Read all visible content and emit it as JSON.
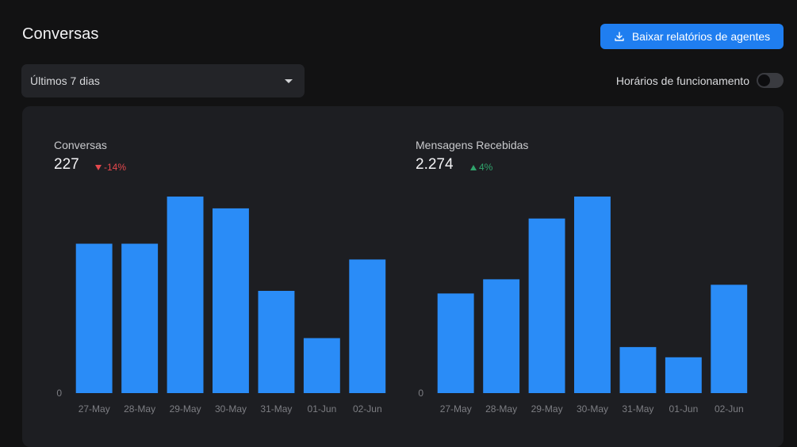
{
  "header": {
    "title": "Conversas",
    "download_label": "Baixar relatórios de agentes",
    "download_icon": "download-icon"
  },
  "filters": {
    "range_value": "Últimos 7 dias",
    "business_hours_label": "Horários de funcionamento",
    "business_hours_on": false
  },
  "colors": {
    "bar": "#2a8cf7",
    "negative": "#e5484d",
    "positive": "#30a46c",
    "accent": "#1f7ef0"
  },
  "cards": [
    {
      "label": "Conversas",
      "total": "227",
      "delta": "-14%",
      "delta_direction": "down"
    },
    {
      "label": "Mensagens Recebidas",
      "total": "2.274",
      "delta": "4%",
      "delta_direction": "up"
    }
  ],
  "chart_data": [
    {
      "type": "bar",
      "title": "",
      "categories": [
        "27-May",
        "28-May",
        "29-May",
        "30-May",
        "31-May",
        "01-Jun",
        "02-Jun"
      ],
      "values": [
        38,
        38,
        50,
        47,
        26,
        14,
        34
      ],
      "ylim": [
        0,
        50
      ],
      "y_ticks": [
        "0"
      ],
      "grid": false
    },
    {
      "type": "bar",
      "title": "",
      "categories": [
        "27-May",
        "28-May",
        "29-May",
        "30-May",
        "31-May",
        "01-Jun",
        "02-Jun"
      ],
      "values": [
        331,
        378,
        580,
        653,
        153,
        119,
        360
      ],
      "ylim": [
        0,
        653
      ],
      "y_ticks": [
        "0"
      ],
      "grid": false
    }
  ]
}
